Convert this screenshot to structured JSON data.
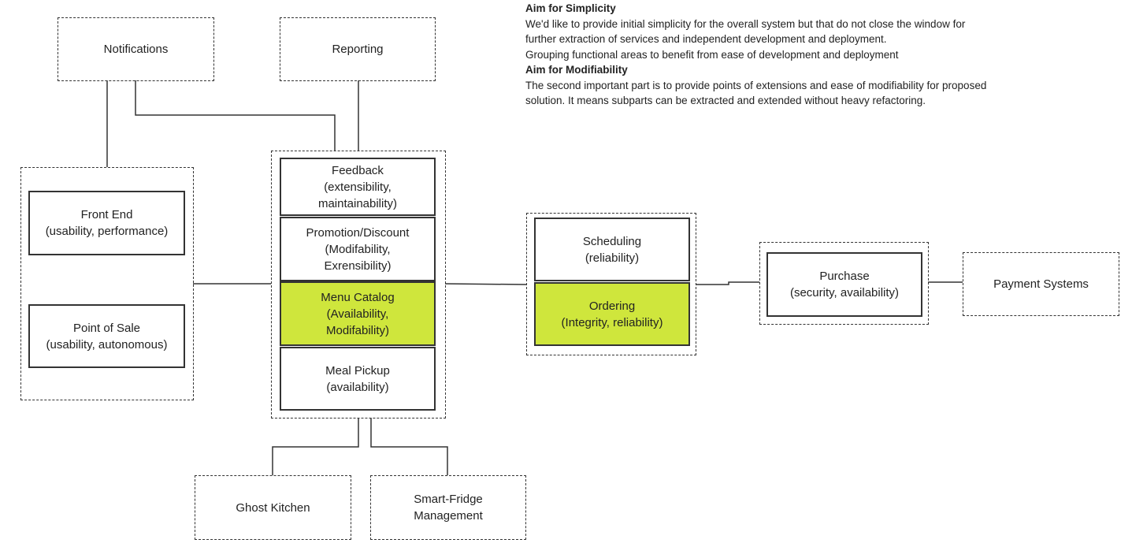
{
  "notes": {
    "simplicity_title": "Aim for Simplicity",
    "simplicity_lines": [
      "We'd like to provide initial simplicity for the overall system but that do not close the window for",
      "further extraction of services and independent development and deployment.",
      "Grouping functional areas to benefit from ease of development and deployment"
    ],
    "modifiability_title": "Aim for Modifiability",
    "modifiability_lines": [
      "The second important part is to provide points of extensions and ease of modifiability for proposed",
      "solution. It means subparts can be extracted and extended without heavy refactoring."
    ]
  },
  "nodes": {
    "notifications": "Notifications",
    "reporting": "Reporting",
    "front_end": "Front End\n(usability, performance)",
    "point_of_sale": "Point of Sale\n(usability, autonomous)",
    "feedback": "Feedback\n(extensibility,\nmaintainability)",
    "promotion": "Promotion/Discount\n(Modifability,\nExrensibility)",
    "menu_catalog": "Menu Catalog\n(Availability,\nModifability)",
    "meal_pickup": "Meal Pickup\n(availability)",
    "scheduling": "Scheduling\n(reliability)",
    "ordering": "Ordering\n(Integrity, reliability)",
    "purchase": "Purchase\n(security, availability)",
    "payment_systems": "Payment Systems",
    "ghost_kitchen": "Ghost Kitchen",
    "smart_fridge": "Smart-Fridge\nManagement"
  },
  "colors": {
    "highlight": "#cfe63c",
    "stroke": "#333333"
  }
}
